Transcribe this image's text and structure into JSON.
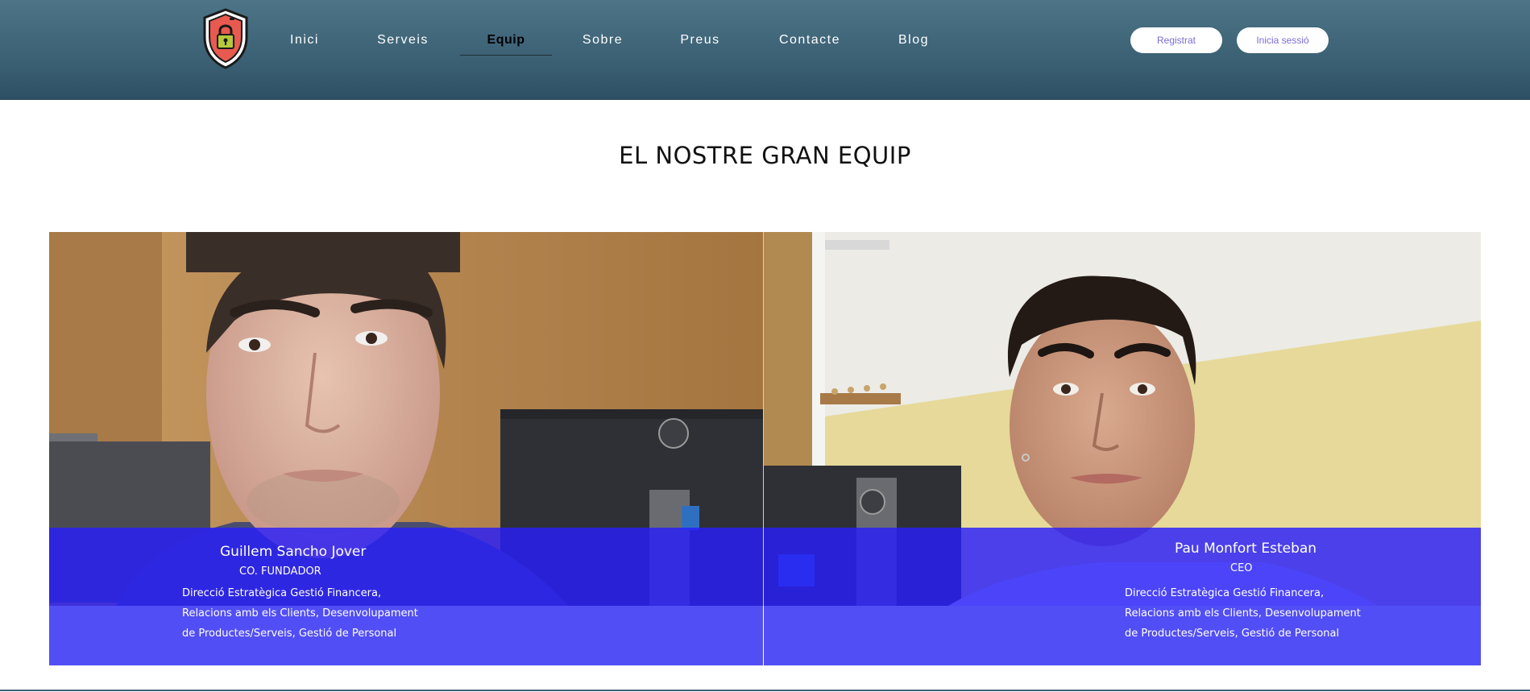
{
  "nav": {
    "items": [
      {
        "label": "Inici"
      },
      {
        "label": "Serveis"
      },
      {
        "label": "Equip"
      },
      {
        "label": "Sobre"
      },
      {
        "label": "Preus"
      },
      {
        "label": "Contacte"
      },
      {
        "label": "Blog"
      }
    ],
    "active": "Equip"
  },
  "header": {
    "register_label": "Registrat",
    "login_label": "Inicia sessió",
    "logo_icon": "shield-lock-icon"
  },
  "main": {
    "title": "EL NOSTRE GRAN EQUIP"
  },
  "team": [
    {
      "name": "Guillem Sancho Jover",
      "role": "CO. FUNDADOR",
      "desc_lines": [
        "Direcció Estratègica Gestió Financera,",
        "Relacions amb els Clients, Desenvolupament",
        "de Productes/Serveis, Gestió de Personal"
      ]
    },
    {
      "name": "Pau Monfort Esteban",
      "role": "CEO",
      "desc_lines": [
        "Direcció Estratègica Gestió Financera,",
        "Relacions amb els Clients, Desenvolupament",
        "de Productes/Serveis, Gestió de Personal"
      ]
    }
  ],
  "colors": {
    "header": "#3d6276",
    "overlay_dark": "#281efa",
    "overlay_light": "#524ef5",
    "button_text": "#7a6cd6"
  }
}
